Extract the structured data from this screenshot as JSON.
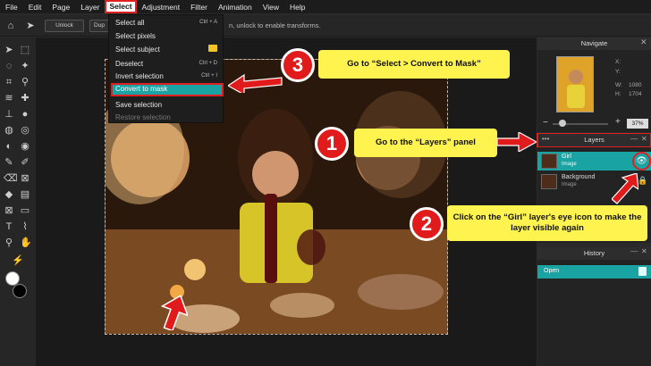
{
  "menubar": {
    "items": [
      "File",
      "Edit",
      "Page",
      "Layer",
      "Select",
      "Adjustment",
      "Filter",
      "Animation",
      "View",
      "Help"
    ]
  },
  "options_bar": {
    "unlock_label": "Unlock",
    "dup_label": "Dup",
    "hint": "n, unlock to enable transforms."
  },
  "select_menu": {
    "items": [
      {
        "label": "Select all",
        "shortcut": "Ctrl + A"
      },
      {
        "label": "Select pixels",
        "shortcut": ""
      },
      {
        "label": "Select subject",
        "shortcut": ""
      },
      {
        "label": "Deselect",
        "shortcut": "Ctrl + D"
      },
      {
        "label": "Invert selection",
        "shortcut": "Ctrl + I"
      },
      {
        "label": "Convert to mask",
        "shortcut": ""
      },
      {
        "label": "Save selection",
        "shortcut": ""
      },
      {
        "label": "Restore selection",
        "shortcut": ""
      }
    ]
  },
  "navigate": {
    "title": "Navigate",
    "x_label": "X:",
    "y_label": "Y:",
    "w_label": "W:",
    "w_value": "1080",
    "h_label": "H:",
    "h_value": "1704",
    "zoom": "37%"
  },
  "layers": {
    "title": "Layers",
    "items": [
      {
        "name": "Girl",
        "type": "Image"
      },
      {
        "name": "Background",
        "type": "Image"
      }
    ]
  },
  "history": {
    "title": "History",
    "items": [
      "Open"
    ]
  },
  "callouts": {
    "step1_num": "1",
    "step1_text": "Go to the “Layers” panel",
    "step2_num": "2",
    "step2_text": "Click on the “Girl” layer's eye icon to make the layer visible again",
    "step3_num": "3",
    "step3_text": "Go to “Select > Convert to Mask”"
  },
  "colors": {
    "accent": "#1aa3a3",
    "callout_bg": "#fff44f",
    "marker": "#e11b1b"
  }
}
